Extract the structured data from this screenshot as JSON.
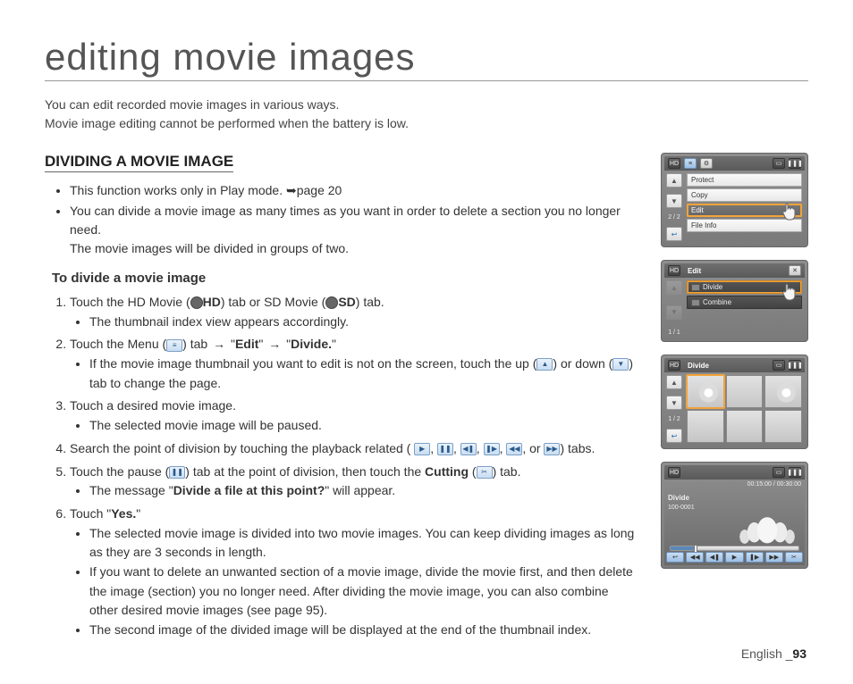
{
  "page": {
    "title": "editing movie images",
    "intro_line1": "You can edit recorded movie images in various ways.",
    "intro_line2": "Movie image editing cannot be performed when the battery is low.",
    "section_header": "DIVIDING A MOVIE IMAGE",
    "footer_lang": "English",
    "footer_page": "93"
  },
  "bullets_top": {
    "b1_pre": "This function works only in Play mode. ",
    "b1_ref": "➥page 20",
    "b2_line1": "You can divide a movie image as many times as you want in order to delete a section you no longer need.",
    "b2_line2": "The movie images will be divided in groups of two."
  },
  "sub_heading": "To divide a movie image",
  "steps": {
    "s1_a": "Touch the HD Movie (",
    "s1_hd": "HD",
    "s1_b": ") tab or SD Movie (",
    "s1_sd": "SD",
    "s1_c": ") tab.",
    "s1_sub": "The thumbnail index view appears accordingly.",
    "s2_a": "Touch the Menu (",
    "s2_b": ") tab ",
    "s2_arrow": "→",
    "s2_edit": "Edit",
    "s2_divide": "Divide.",
    "s2_c_q1": " \"",
    "s2_c_q2": "\" ",
    "s2_sub_a": "If the movie image thumbnail you want to edit is not on the screen, touch the up (",
    "s2_sub_b": ") or down (",
    "s2_sub_c": ") tab to change the page.",
    "s3": "Touch a desired movie image.",
    "s3_sub": "The selected movie image will be paused.",
    "s4_a": "Search the point of division by touching the playback related (",
    "s4_b": ") tabs.",
    "s4_or": ", or",
    "s5_a": "Touch the pause (",
    "s5_b": ")  tab at the point of division, then touch the ",
    "s5_cut": "Cutting",
    "s5_c": " (",
    "s5_d": ") tab.",
    "s5_sub_a": "The message \"",
    "s5_sub_q": "Divide a file at this point?",
    "s5_sub_b": "\" will appear.",
    "s6_a": "Touch \"",
    "s6_yes": "Yes.",
    "s6_b": "\"",
    "s6_sub1": "The selected movie image is divided into two movie images. You can keep dividing images as long as they are 3 seconds in length.",
    "s6_sub2": "If you want to delete an unwanted section of a movie image, divide the movie first, and then delete the image (section) you no longer need. After dividing the movie image, you can also combine other desired movie images (see page 95).",
    "s6_sub3": "The second image of the divided image will be displayed at the end of the thumbnail index."
  },
  "icons": {
    "menu": "≡",
    "up": "▲",
    "down": "▼",
    "play": "▶",
    "pause": "❚❚",
    "step_back": "◀❚",
    "step_fwd": "❚▶",
    "rew": "◀◀",
    "ff": "▶▶",
    "cut": "✂",
    "comma": ", "
  },
  "screens": {
    "s1": {
      "counter": "2 / 2",
      "items": {
        "protect": "Protect",
        "copy": "Copy",
        "edit": "Edit",
        "fileinfo": "File Info"
      }
    },
    "s2": {
      "title": "Edit",
      "counter": "1 / 1",
      "items": {
        "divide": "Divide",
        "combine": "Combine"
      }
    },
    "s3": {
      "title": "Divide",
      "counter": "1 / 2"
    },
    "s4": {
      "title": "Divide",
      "time": "00:15:00 / 00:30:00",
      "counter": "100-0001"
    }
  }
}
